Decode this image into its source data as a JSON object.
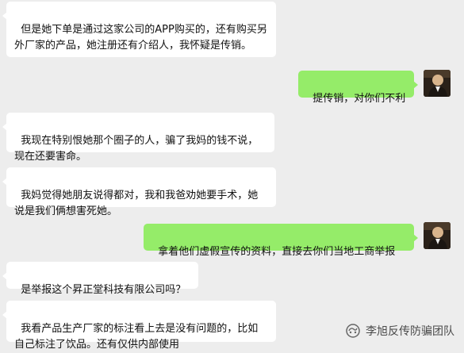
{
  "chat": {
    "messages": [
      {
        "side": "in",
        "text": "但是她下单是通过这家公司的APP购买的，还有购买另外厂家的产品，她注册还有介绍人，我怀疑是传销。"
      },
      {
        "side": "out",
        "text": "提传销，对你们不利"
      },
      {
        "side": "in",
        "text": "我现在特别恨她那个圈子的人，骗了我妈的钱不说，现在还要害命。"
      },
      {
        "side": "in",
        "text": "我妈觉得她朋友说得都对，我和我爸劝她要手术，她说是我们俩想害死她。"
      },
      {
        "side": "out",
        "text": "拿着他们虚假宣传的资料，直接去你们当地工商举报"
      },
      {
        "side": "in",
        "text": "是举报这个昇正堂科技有限公司吗？"
      },
      {
        "side": "in",
        "text": "我看产品生产厂家的标注看上去是没有问题的，比如自己标注了饮品。还有仅供内部使用"
      }
    ]
  },
  "watermark": {
    "text": "李旭反传防骗团队",
    "icon": "wechat-official-account-icon"
  },
  "colors": {
    "background": "#ededed",
    "incoming": "#ffffff",
    "outgoing": "#95ec69"
  }
}
